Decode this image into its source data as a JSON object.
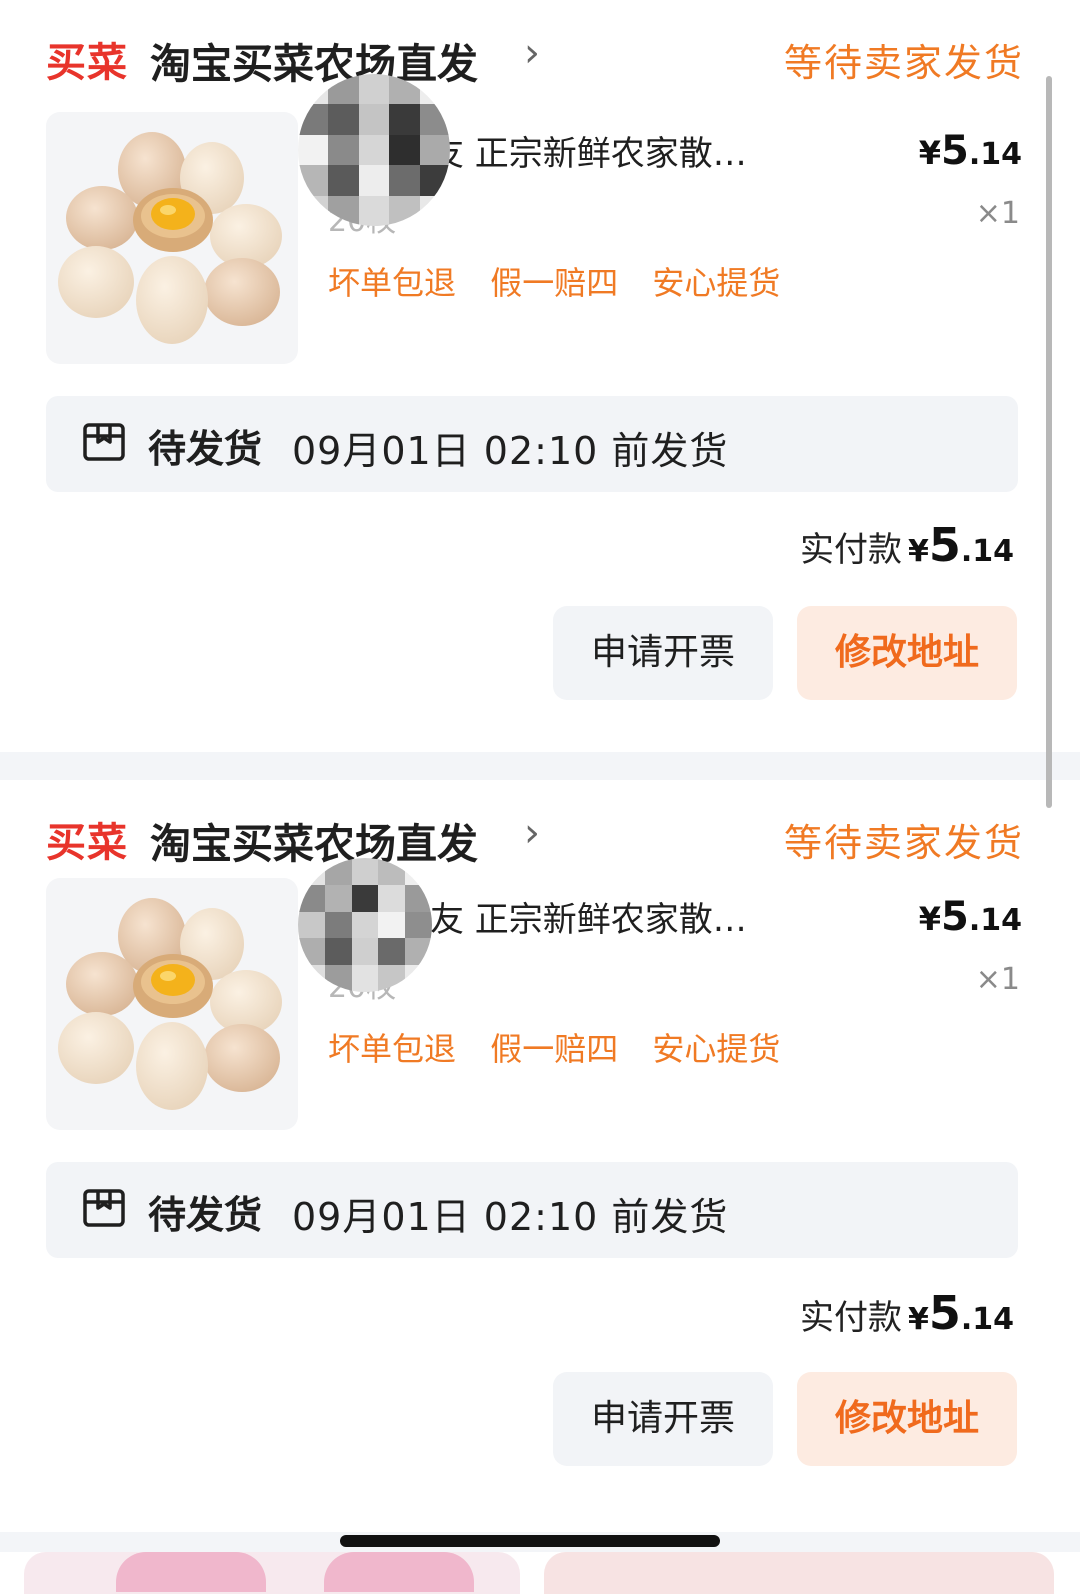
{
  "orders": [
    {
      "shop_badge": "买菜",
      "shop_name": "淘宝买菜农场直发",
      "chevron": "›",
      "status": "等待卖家发货",
      "product_title": "交个朋友 正宗新鲜农家散…",
      "spec": "20枚",
      "price": {
        "currency": "¥",
        "int": "5",
        "dec": ".14"
      },
      "qty": "×1",
      "tags": [
        "坏单包退",
        "假一赔四",
        "安心提货"
      ],
      "shipping": {
        "label": "待发货",
        "time": "09月01日 02:10 前发货",
        "icon": "package-box-icon"
      },
      "total": {
        "label": "实付款",
        "currency": "¥",
        "int": "5",
        "dec": ".14"
      },
      "buttons": {
        "invoice": "申请开票",
        "address": "修改地址"
      }
    },
    {
      "shop_badge": "买菜",
      "shop_name": "淘宝买菜农场直发",
      "chevron": "›",
      "status": "等待卖家发货",
      "product_title": "交个朋友 正宗新鲜农家散…",
      "spec": "20枚",
      "price": {
        "currency": "¥",
        "int": "5",
        "dec": ".14"
      },
      "qty": "×1",
      "tags": [
        "坏单包退",
        "假一赔四",
        "安心提货"
      ],
      "shipping": {
        "label": "待发货",
        "time": "09月01日 02:10 前发货",
        "icon": "package-box-icon"
      },
      "total": {
        "label": "实付款",
        "currency": "¥",
        "int": "5",
        "dec": ".14"
      },
      "buttons": {
        "invoice": "申请开票",
        "address": "修改地址"
      }
    }
  ],
  "colors": {
    "brand_red": "#e8342b",
    "status_orange": "#f07a24",
    "address_button_bg": "#fdebe1",
    "neutral_bg": "#f2f4f7"
  }
}
